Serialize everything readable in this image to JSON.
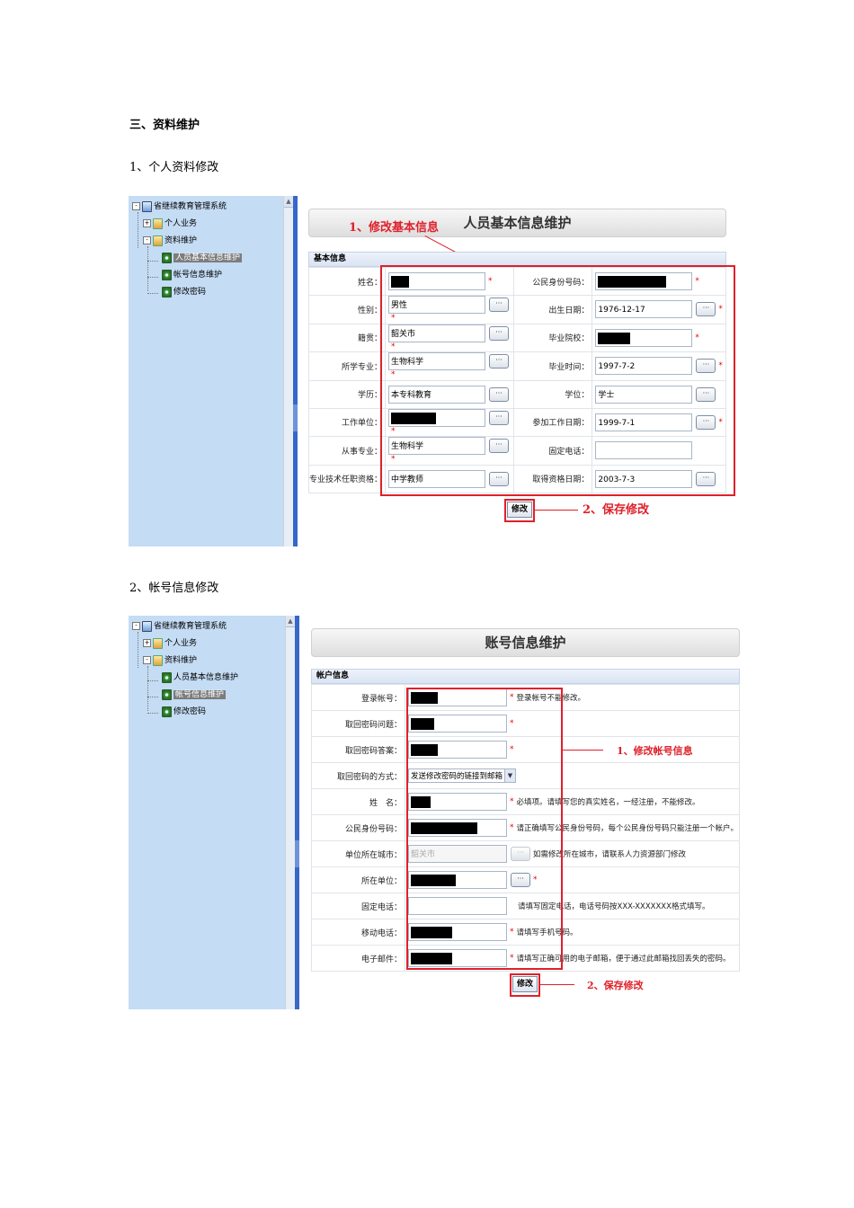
{
  "section_title": "三、资料维护",
  "sub1": "1、个人资料修改",
  "sub2": "2、帐号信息修改",
  "tree": {
    "root": "省继续教育管理系统",
    "personal": "个人业务",
    "maintenance": "资料维护",
    "basic_info": "人员基本信息维护",
    "account_info": "帐号信息维护",
    "change_password": "修改密码"
  },
  "shot1": {
    "title": "人员基本信息维护",
    "section": "基本信息",
    "annotation1": "1、修改基本信息",
    "annotation2": "2、保存修改",
    "save_button": "修改",
    "rows": [
      {
        "l1": "姓名：",
        "v1": "",
        "r1": true,
        "b1": false,
        "s1": true,
        "l2": "公民身份号码：",
        "v2": "",
        "r2": true,
        "b2": false,
        "s2": true
      },
      {
        "l1": "性别：",
        "v1": "男性",
        "r1": false,
        "b1": true,
        "s1": true,
        "l2": "出生日期：",
        "v2": "1976-12-17",
        "r2": false,
        "b2": true,
        "s2": true
      },
      {
        "l1": "籍贯：",
        "v1": "韶关市",
        "r1": false,
        "b1": true,
        "s1": true,
        "l2": "毕业院校：",
        "v2": "",
        "r2": true,
        "b2": false,
        "s2": true
      },
      {
        "l1": "所学专业：",
        "v1": "生物科学",
        "r1": false,
        "b1": true,
        "s1": true,
        "l2": "毕业时间：",
        "v2": "1997-7-2",
        "r2": false,
        "b2": true,
        "s2": true
      },
      {
        "l1": "学历：",
        "v1": "本专科教育",
        "r1": false,
        "b1": true,
        "s1": false,
        "l2": "学位：",
        "v2": "学士",
        "r2": false,
        "b2": true,
        "s2": false
      },
      {
        "l1": "工作单位：",
        "v1": "",
        "r1": true,
        "b1": true,
        "s1": true,
        "l2": "参加工作日期：",
        "v2": "1999-7-1",
        "r2": false,
        "b2": true,
        "s2": true
      },
      {
        "l1": "从事专业：",
        "v1": "生物科学",
        "r1": false,
        "b1": true,
        "s1": true,
        "l2": "固定电话：",
        "v2": "",
        "r2": false,
        "b2": false,
        "s2": false
      },
      {
        "l1": "专业技术任职资格：",
        "v1": "中学教师",
        "r1": false,
        "b1": true,
        "s1": false,
        "l2": "取得资格日期：",
        "v2": "2003-7-3",
        "r2": false,
        "b2": true,
        "s2": false
      }
    ]
  },
  "shot2": {
    "title": "账号信息维护",
    "section": "帐户信息",
    "annotation1": "1、修改帐号信息",
    "annotation2": "2、保存修改",
    "save_button": "修改",
    "rows": [
      {
        "label": "登录帐号：",
        "value": "",
        "redact": true,
        "redact_w": 30,
        "dots": false,
        "star": true,
        "hint": "登录帐号不能修改。",
        "type": "input"
      },
      {
        "label": "取回密码问题：",
        "value": "",
        "redact": true,
        "redact_w": 26,
        "dots": false,
        "star": true,
        "hint": "",
        "type": "input"
      },
      {
        "label": "取回密码答案：",
        "value": "",
        "redact": true,
        "redact_w": 30,
        "dots": false,
        "star": true,
        "hint": "",
        "type": "input"
      },
      {
        "label": "取回密码的方式：",
        "value": "发送修改密码的链接到邮箱",
        "redact": false,
        "dots": false,
        "star": false,
        "hint": "",
        "type": "select"
      },
      {
        "label": "姓　名：",
        "value": "",
        "redact": true,
        "redact_w": 22,
        "dots": false,
        "star": true,
        "hint": "必填项。请填写您的真实姓名，一经注册，不能修改。",
        "type": "input"
      },
      {
        "label": "公民身份号码：",
        "value": "",
        "redact": true,
        "redact_w": 74,
        "dots": false,
        "star": true,
        "hint": "请正确填写公民身份号码，每个公民身份号码只能注册一个帐户。",
        "type": "input"
      },
      {
        "label": "单位所在城市：",
        "value": "韶关市",
        "redact": false,
        "dots": true,
        "star": false,
        "hint": "如需修改所在城市，请联系人力资源部门修改",
        "type": "disabled"
      },
      {
        "label": "所在单位：",
        "value": "",
        "redact": true,
        "redact_w": 50,
        "dots": true,
        "star": true,
        "hint": "",
        "type": "input"
      },
      {
        "label": "固定电话：",
        "value": "",
        "redact": false,
        "dots": false,
        "star": false,
        "hint": "请填写固定电话，电话号码按XXX-XXXXXXX格式填写。",
        "type": "input"
      },
      {
        "label": "移动电话：",
        "value": "",
        "redact": true,
        "redact_w": 46,
        "dots": false,
        "star": true,
        "hint": "请填写手机号码。",
        "type": "input"
      },
      {
        "label": "电子邮件：",
        "value": "",
        "redact": true,
        "redact_w": 46,
        "dots": false,
        "star": true,
        "hint": "请填写正确可用的电子邮箱，便于通过此邮箱找回丢失的密码。",
        "type": "input"
      }
    ]
  },
  "colors": {
    "tree_bg": "#c4dcf4",
    "splitter": "#3767c8",
    "annotation": "#e0202a"
  }
}
